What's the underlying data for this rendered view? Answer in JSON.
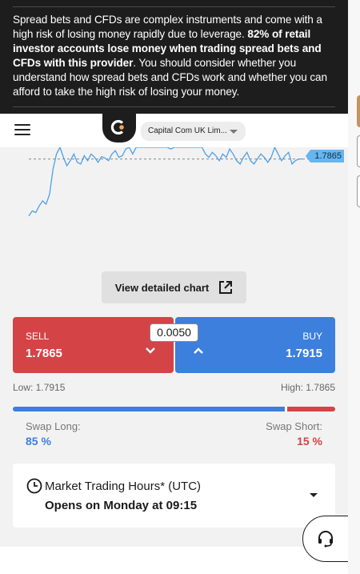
{
  "risk_warning": {
    "part1": "Spread bets and CFDs are complex instruments and come with a high risk of losing money rapidly due to leverage. ",
    "bold": "82% of retail investor accounts lose money when trading spread bets and CFDs with this provider",
    "part2": ". You should consider whether you understand how spread bets and CFDs work and whether you can afford to take the high risk of losing your money."
  },
  "header": {
    "menu_icon": "hamburger-icon",
    "logo_icon": "capital-com-logo",
    "entity_select": "Capital Com UK Lim..."
  },
  "chart": {
    "current_price": "1.7865",
    "detail_button": "View detailed chart",
    "detail_icon": "external-link-icon"
  },
  "chart_data": {
    "type": "line",
    "x": [
      0,
      1,
      2,
      3,
      4,
      5,
      6,
      7,
      8,
      9,
      10,
      11,
      12,
      13,
      14,
      15,
      16,
      17,
      18,
      19,
      20,
      21,
      22,
      23,
      24,
      25,
      26,
      27,
      28,
      29,
      30,
      31,
      32,
      33,
      34,
      35,
      36,
      37,
      38,
      39,
      40,
      41,
      42,
      43,
      44,
      45,
      46,
      47,
      48,
      49,
      50,
      51,
      52,
      53,
      54,
      55,
      56,
      57,
      58,
      59,
      60,
      61,
      62,
      63,
      64,
      65,
      66,
      67,
      68,
      69,
      70,
      71,
      72,
      73,
      74,
      75,
      76,
      77,
      78,
      79
    ],
    "values": [
      1.7695,
      1.771,
      1.7705,
      1.7725,
      1.774,
      1.773,
      1.776,
      1.7835,
      1.788,
      1.79,
      1.787,
      1.7845,
      1.786,
      1.788,
      1.7855,
      1.785,
      1.7875,
      1.786,
      1.788,
      1.787,
      1.7855,
      1.7872,
      1.7868,
      1.786,
      1.788,
      1.789,
      1.787,
      1.7875,
      1.7895,
      1.79,
      1.788,
      1.79,
      1.79,
      1.79,
      1.79,
      1.79,
      1.79,
      1.79,
      1.79,
      1.79,
      1.79,
      1.7895,
      1.79,
      1.79,
      1.79,
      1.79,
      1.79,
      1.79,
      1.79,
      1.79,
      1.79,
      1.788,
      1.787,
      1.7885,
      1.7875,
      1.786,
      1.788,
      1.787,
      1.7895,
      1.788,
      1.786,
      1.785,
      1.787,
      1.7885,
      1.786,
      1.785,
      1.7865,
      1.788,
      1.787,
      1.7855,
      1.787,
      1.79,
      1.788,
      1.786,
      1.7875,
      1.7885,
      1.785,
      1.786,
      1.7865,
      1.7865
    ],
    "current": 1.7865,
    "ylim": [
      1.768,
      1.79
    ],
    "grid": false
  },
  "trade": {
    "sell_label": "SELL",
    "sell_price": "1.7865",
    "buy_label": "BUY",
    "buy_price": "1.7915",
    "spread": "0.0050",
    "low": "Low: 1.7915",
    "high": "High: 1.7865",
    "long_pct": 85,
    "swap_long_label": "Swap Long:",
    "swap_long_value": "85 %",
    "swap_short_label": "Swap Short:",
    "swap_short_value": "15 %",
    "sell_color": "#d44447",
    "buy_color": "#3d7fdc"
  },
  "hours": {
    "title": "Market Trading Hours* (UTC)",
    "opens": "Opens on Monday at 09:15",
    "clock_icon": "clock-icon",
    "toggle_icon": "caret-down-icon"
  },
  "support": {
    "icon": "headset-icon"
  }
}
